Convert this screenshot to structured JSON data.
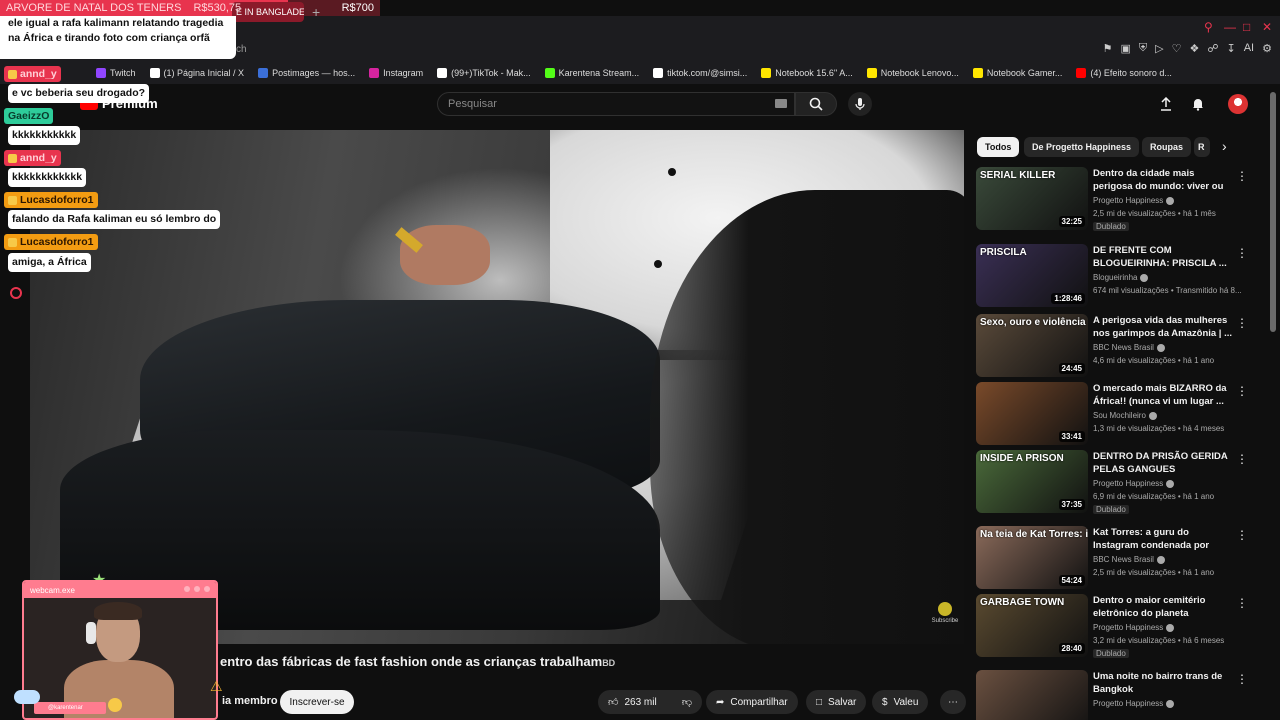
{
  "overlay": {
    "goal_label": "ARVORE DE NATAL DOS TENERS",
    "goal_current": "R$530,75",
    "goal_target": "R$700",
    "goal_progress": 0.758,
    "top_message": "ele igual a rafa kalimann relatando tragedia na África e tirando foto com criança orfã",
    "chat": [
      {
        "user": "annd_y",
        "user_color": "red",
        "message": "e vc beberia seu drogado?"
      },
      {
        "user": "GaeizzO",
        "user_color": "green",
        "message": "kkkkkkkkkkk"
      },
      {
        "user": "annd_y",
        "user_color": "red",
        "message": "kkkkkkkkkkkk"
      },
      {
        "user": "Lucasdoforro1",
        "user_color": "orange",
        "message": "falando da Rafa kaliman eu só lembro do"
      },
      {
        "user": "Lucasdoforro1",
        "user_color": "orange",
        "message": "amiga, a África"
      }
    ],
    "webcam_title": "webcam.exe",
    "webcam_handle": "@karentenar"
  },
  "browser": {
    "active_tab": "E IN BANGLADE",
    "new_tab": "+",
    "address_fragment": "ch",
    "bookmarks": [
      {
        "label": "Twitch",
        "icon": "twitch-icon",
        "color": "#9146ff"
      },
      {
        "label": "(1) Página Inicial / X",
        "icon": "x-icon",
        "color": "#ffffff"
      },
      {
        "label": "Postimages — hos...",
        "icon": "postimages-icon",
        "color": "#3b6fd8"
      },
      {
        "label": "Instagram",
        "icon": "instagram-icon",
        "color": "#d6249f"
      },
      {
        "label": "(99+)TikTok - Mak...",
        "icon": "tiktok-icon",
        "color": "#ffffff"
      },
      {
        "label": "Karentena Stream...",
        "icon": "kick-icon",
        "color": "#53fc18"
      },
      {
        "label": "tiktok.com/@simsi...",
        "icon": "tiktok-icon",
        "color": "#ffffff"
      },
      {
        "label": "Notebook 15.6'' A...",
        "icon": "ml-icon",
        "color": "#ffe600"
      },
      {
        "label": "Notebook Lenovo...",
        "icon": "ml-icon",
        "color": "#ffe600"
      },
      {
        "label": "Notebook Gamer...",
        "icon": "ml-icon",
        "color": "#ffe600"
      },
      {
        "label": "(4) Efeito sonoro d...",
        "icon": "youtube-icon",
        "color": "#ff0000"
      }
    ]
  },
  "youtube": {
    "logo": "Premium",
    "search_placeholder": "Pesquisar",
    "chips": [
      "Todos",
      "De Progetto Happiness",
      "Roupas",
      "R"
    ],
    "video_title": "entro das fábricas de fast fashion onde as crianças trabalham",
    "video_title_suffix": "BD",
    "watermark": "Subscribe",
    "join_label": "ia membro",
    "subscribe": "Inscrever-se",
    "likes": "263 mil",
    "share": "Compartilhar",
    "save": "Salvar",
    "thanks": "Valeu",
    "recommendations": [
      {
        "thumb_text": "SERIAL KILLER",
        "duration": "32:25",
        "title": "Dentro da cidade mais perigosa do mundo: viver ou morrer na ...",
        "channel": "Progetto Happiness",
        "meta": "2,5 mi de visualizações • há 1 mês",
        "badge": "Dublado",
        "bg": "#3a4a3a"
      },
      {
        "thumb_text": "PRISCILA",
        "duration": "1:28:46",
        "title": "DE FRENTE COM BLOGUEIRINHA: PRISCILA ...",
        "channel": "Blogueirinha",
        "meta": "674 mil visualizações • Transmitido há 8...",
        "badge": "",
        "bg": "#3a2f55"
      },
      {
        "thumb_text": "Sexo, ouro e violência",
        "duration": "24:45",
        "title": "A perigosa vida das mulheres nos garimpos da Amazônia | ...",
        "channel": "BBC News Brasil",
        "meta": "4,6 mi de visualizações • há 1 ano",
        "badge": "",
        "bg": "#5a4a3a"
      },
      {
        "thumb_text": "",
        "duration": "33:41",
        "title": "O mercado mais BIZARRO da África!! (nunca vi um lugar ...",
        "channel": "Sou Mochileiro",
        "meta": "1,3 mi de visualizações • há 4 meses",
        "badge": "",
        "bg": "#7a4a2a"
      },
      {
        "thumb_text": "INSIDE A PRISON",
        "duration": "37:35",
        "title": "DENTRO DA PRISÃO GERIDA PELAS GANGUES",
        "channel": "Progetto Happiness",
        "meta": "6,9 mi de visualizações • há 1 ano",
        "badge": "Dublado",
        "bg": "#4a6a3a"
      },
      {
        "thumb_text": "Na teia de Kat Torres: ilusão e terror",
        "duration": "54:24",
        "title": "Kat Torres: a guru do Instagram condenada por tráfico humano...",
        "channel": "BBC News Brasil",
        "meta": "2,5 mi de visualizações • há 1 ano",
        "badge": "",
        "bg": "#8a6a5a"
      },
      {
        "thumb_text": "GARBAGE TOWN",
        "duration": "28:40",
        "title": "Dentro o maior cemitério eletrônico do planeta",
        "channel": "Progetto Happiness",
        "meta": "3,2 mi de visualizações • há 6 meses",
        "badge": "Dublado",
        "bg": "#5a4a30"
      },
      {
        "thumb_text": "",
        "duration": "",
        "title": "Uma noite no bairro trans de Bangkok",
        "channel": "Progetto Happiness",
        "meta": "",
        "badge": "",
        "bg": "#6a5040"
      }
    ]
  }
}
